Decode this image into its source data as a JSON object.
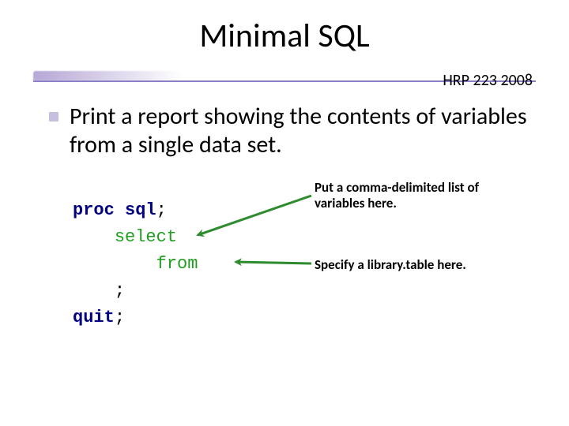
{
  "title": "Minimal SQL",
  "course_tag": "HRP 223 2008",
  "bullet": "Print a report showing the contents of variables from a single data set.",
  "code": {
    "proc": "proc",
    "sql": "sql",
    "semicolon": ";",
    "select": "select",
    "from": "from",
    "quit": "quit"
  },
  "annotations": {
    "vars": "Put a comma-delimited list of variables here.",
    "table": "Specify a library.table here."
  }
}
